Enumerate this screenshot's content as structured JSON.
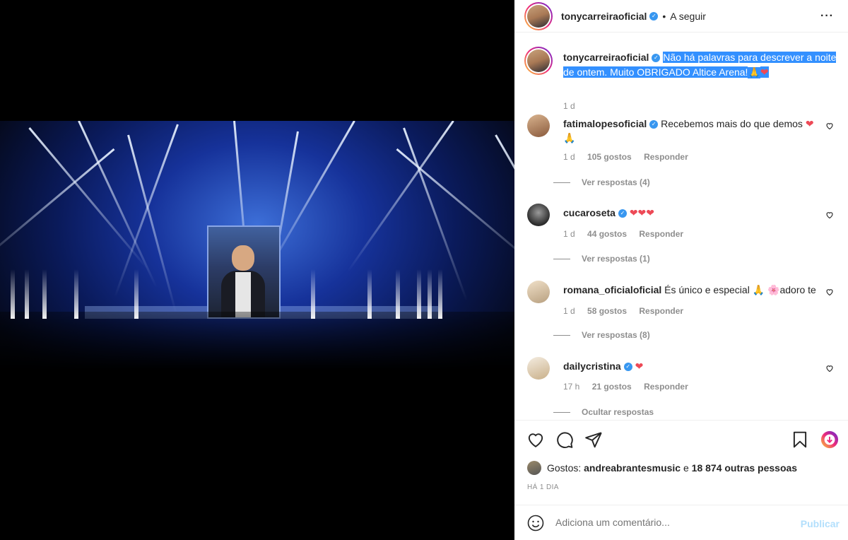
{
  "post": {
    "image_icon": "concert-photo",
    "author": "tonycarreiraoficial",
    "follow_status": "A seguir",
    "dot": "•",
    "caption_user": "tonycarreiraoficial",
    "caption_text": "Não há palavras para descrever a noite de ontem. Muito OBRIGADO Altice Arena!",
    "caption_emoji": "🙏",
    "caption_heart": "❤",
    "caption_time": "1 d"
  },
  "comments": [
    {
      "user": "fatimalopesoficial",
      "text": "Recebemos mais do que demos",
      "emoji_heart": "❤",
      "emoji_pray": "🙏",
      "time": "1 d",
      "likes": "105 gostos",
      "reply": "Responder",
      "replies": "Ver respostas (4)"
    },
    {
      "user": "cucaroseta",
      "hearts": "❤❤❤",
      "time": "1 d",
      "likes": "44 gostos",
      "reply": "Responder",
      "replies": "Ver respostas (1)"
    },
    {
      "user": "romana_oficialoficial",
      "text": "És único e especial",
      "emoji_pray": "🙏",
      "emoji_flower": "🌸",
      "text2": "adoro te",
      "time": "1 d",
      "likes": "58 gostos",
      "reply": "Responder",
      "replies": "Ver respostas (8)"
    },
    {
      "user": "dailycristina",
      "hearts": "❤",
      "time": "17 h",
      "likes": "21 gostos",
      "reply": "Responder",
      "replies": "Ocultar respostas"
    }
  ],
  "likes": {
    "prefix": "Gostos:",
    "user": "andreabrantesmusic",
    "connector": "e",
    "others": "18 874 outras pessoas"
  },
  "time_ago": "HÁ 1 DIA",
  "add_comment": {
    "placeholder": "Adiciona um comentário...",
    "publish": "Publicar"
  },
  "colors": {
    "accent": "#3897f0",
    "like_red": "#ed4956",
    "highlight": "#3390ff",
    "publish_disabled": "#b2dffc"
  }
}
